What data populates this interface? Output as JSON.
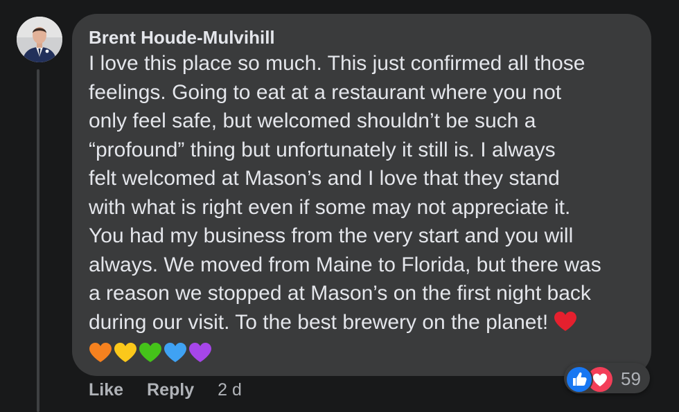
{
  "comment": {
    "author": "Brent Houde-Mulvihill",
    "avatar_icon": "profile-photo",
    "lines": [
      "I love this place so much. This just confirmed all those",
      "feelings. Going to eat at a restaurant where you not",
      "only feel safe, but welcomed shouldn’t be such a",
      "“profound” thing but unfortunately it still is. I always",
      "felt welcomed at Mason’s and I love that they stand",
      "with what is right even if some may not appreciate it.",
      "You had my business from the very start and you will",
      "always. We moved from Maine to Florida, but there was",
      "a reason we stopped at Mason’s on the first night back",
      "during our visit. To the best brewery on the planet!"
    ],
    "emojis": [
      {
        "name": "red-heart-icon",
        "color": "#e5202e"
      },
      {
        "name": "orange-heart-icon",
        "color": "#f5811f"
      },
      {
        "name": "yellow-heart-icon",
        "color": "#fbc81b"
      },
      {
        "name": "green-heart-icon",
        "color": "#45c31a"
      },
      {
        "name": "blue-heart-icon",
        "color": "#3fa2f3"
      },
      {
        "name": "purple-heart-icon",
        "color": "#a646e9"
      }
    ]
  },
  "reactions": {
    "count": "59",
    "types": [
      "like-reaction-icon",
      "love-reaction-icon"
    ],
    "like_color": "#1877f2",
    "love_color": "#f33e58"
  },
  "actions": {
    "like_label": "Like",
    "reply_label": "Reply",
    "timestamp": "2 d"
  },
  "colors": {
    "background": "#18191a",
    "bubble": "#3a3b3c",
    "primary_text": "#e4e6eb",
    "secondary_text": "#b0b3b8"
  }
}
